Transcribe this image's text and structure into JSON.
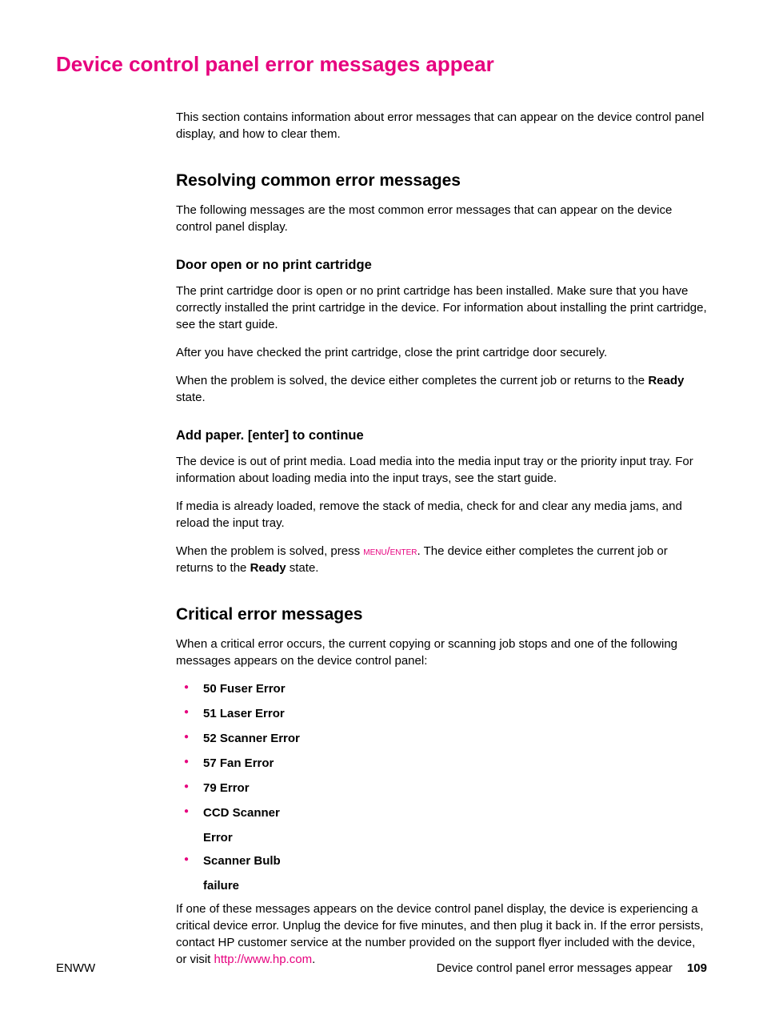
{
  "title": "Device control panel error messages appear",
  "intro": "This section contains information about error messages that can appear on the device control panel display, and how to clear them.",
  "section1": {
    "heading": "Resolving common error messages",
    "intro": "The following messages are the most common error messages that can appear on the device control panel display.",
    "sub1": {
      "heading": "Door open or no print cartridge",
      "p1": "The print cartridge door is open or no print cartridge has been installed. Make sure that you have correctly installed the print cartridge in the device. For information about installing the print cartridge, see the start guide.",
      "p2": "After you have checked the print cartridge, close the print cartridge door securely.",
      "p3a": "When the problem is solved, the device either completes the current job or returns to the ",
      "p3b": "Ready",
      "p3c": " state."
    },
    "sub2": {
      "heading": "Add paper. [enter] to continue",
      "p1": "The device is out of print media. Load media into the media input tray or the priority input tray. For information about loading media into the input trays, see the start guide.",
      "p2": "If media is already loaded, remove the stack of media, check for and clear any media jams, and reload the input tray.",
      "p3a": "When the problem is solved, press ",
      "p3b": "menu/enter",
      "p3c": ". The device either completes the current job or returns to the ",
      "p3d": "Ready",
      "p3e": " state."
    }
  },
  "section2": {
    "heading": "Critical error messages",
    "intro": "When a critical error occurs, the current copying or scanning job stops and one of the following messages appears on the device control panel:",
    "errors": [
      "50 Fuser Error",
      "51 Laser Error",
      "52 Scanner Error",
      "57 Fan Error",
      "79 Error"
    ],
    "err6a": "CCD Scanner",
    "err6b": "Error",
    "err7a": "Scanner Bulb",
    "err7b": "failure",
    "outro_a": "If one of these messages appears on the device control panel display, the device is experiencing a critical device error. Unplug the device for five minutes, and then plug it back in. If the error persists, contact HP customer service at the number provided on the support flyer included with the device, or visit ",
    "link": "http://www.hp.com",
    "outro_b": "."
  },
  "footer": {
    "left": "ENWW",
    "right_text": "Device control panel error messages appear",
    "page": "109"
  }
}
